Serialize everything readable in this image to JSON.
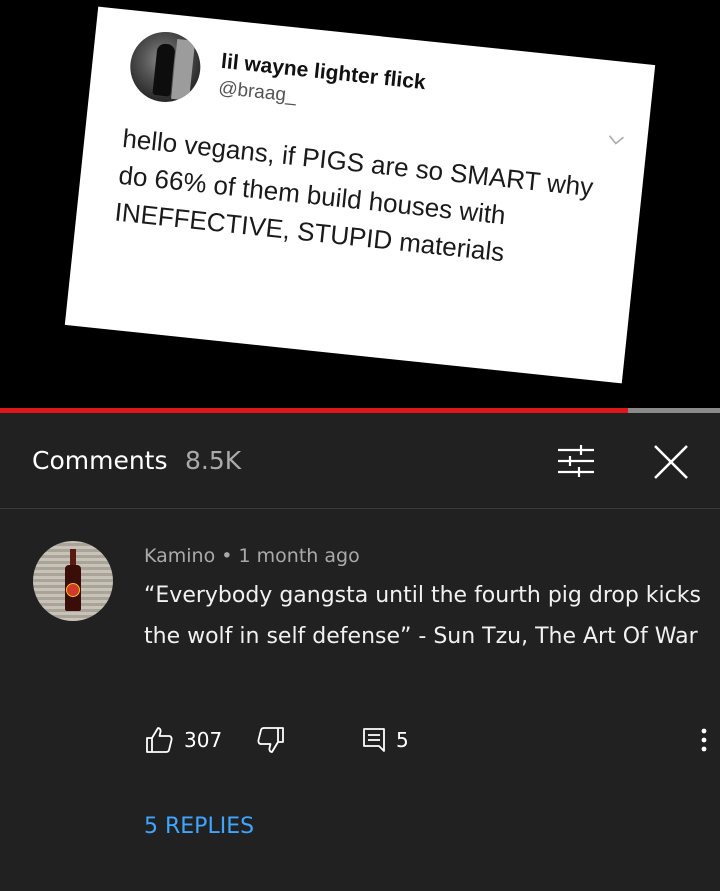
{
  "video": {
    "tweet": {
      "display_name": "lil wayne lighter flick",
      "handle": "@braag_",
      "text": "hello vegans, if PIGS are so SMART why do 66% of them build houses with INEFFECTIVE, STUPID materials"
    },
    "progress_fraction": 0.872,
    "progress_color": "#e0161d"
  },
  "comments_panel": {
    "title": "Comments",
    "count": "8.5K",
    "sort_icon": "sliders-icon",
    "close_icon": "close-icon"
  },
  "comment": {
    "author": "Kamino",
    "separator": "•",
    "time": "1 month ago",
    "text": "“Everybody gangsta until the fourth pig drop kicks the wolf in self defense” - Sun Tzu, The Art Of War",
    "likes": "307",
    "replies_count": "5",
    "replies_link": "5 REPLIES",
    "accent_color": "#3ea6ff"
  }
}
